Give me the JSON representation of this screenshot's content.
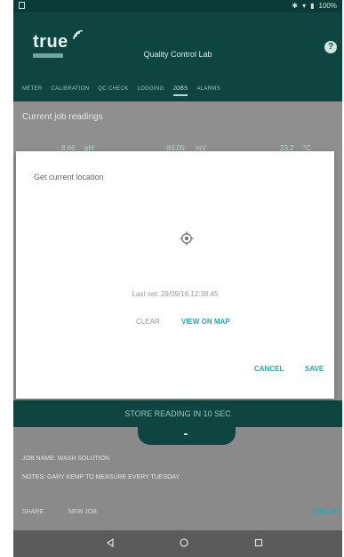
{
  "status_bar": {
    "battery_text": "100%"
  },
  "app": {
    "title": "Quality Control Lab",
    "logo_text": "true"
  },
  "tabs": [
    {
      "label": "METER"
    },
    {
      "label": "CALIBRATION"
    },
    {
      "label": "QC CHECK"
    },
    {
      "label": "LOGGING"
    },
    {
      "label": "JOBS"
    },
    {
      "label": "ALARMS"
    }
  ],
  "content": {
    "title": "Current job readings",
    "readings": {
      "ph_value": "8.66",
      "ph_unit": "pH",
      "mv_value": "-84.05",
      "mv_unit": "mV",
      "temp_value": "23.2",
      "temp_unit": "°C"
    }
  },
  "dialog": {
    "title": "Get current location",
    "last_set": "Last set: 29/09/16 12:38:45",
    "clear_label": "CLEAR",
    "view_map_label": "VIEW ON MAP",
    "cancel_label": "CANCEL",
    "save_label": "SAVE"
  },
  "store_bar": {
    "label": "STORE READING IN 10 SEC"
  },
  "job": {
    "name_label": "JOB NAME: WASH SOLUTION",
    "notes_label": "NOTES: GARY KEMP TO MEASURE EVERY TUESDAY"
  },
  "actions": {
    "share": "SHARE",
    "new_job": "NEW JOB",
    "job_list": "JOB LIST"
  },
  "colors": {
    "app_bar": "#0f4541",
    "accent": "#2aa6b0",
    "dialog": "#ffffff",
    "overlay": "#8f8f8f"
  },
  "icons": {
    "target": "location-target-icon",
    "back": "back-triangle-icon",
    "home": "home-circle-icon",
    "recents": "recents-square-icon",
    "help": "help-icon"
  }
}
